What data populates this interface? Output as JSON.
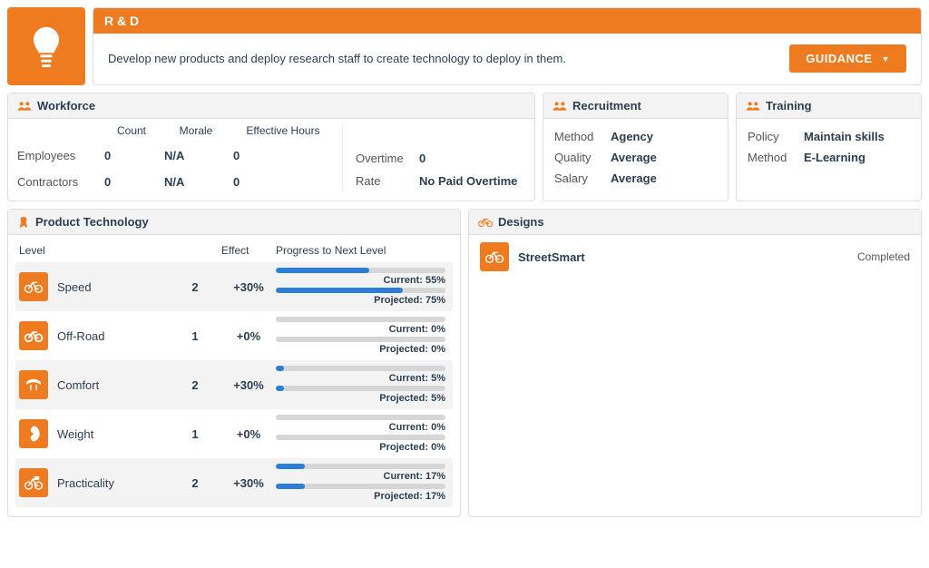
{
  "header": {
    "title": "R & D",
    "description": "Develop new products and deploy research staff to create technology to deploy in them.",
    "guidance_label": "GUIDANCE"
  },
  "workforce": {
    "title": "Workforce",
    "columns": {
      "count": "Count",
      "morale": "Morale",
      "hours": "Effective Hours"
    },
    "rows": {
      "employees_label": "Employees",
      "contractors_label": "Contractors",
      "employees": {
        "count": "0",
        "morale": "N/A",
        "hours": "0"
      },
      "contractors": {
        "count": "0",
        "morale": "N/A",
        "hours": "0"
      }
    },
    "overtime_label": "Overtime",
    "overtime_value": "0",
    "rate_label": "Rate",
    "rate_value": "No Paid Overtime"
  },
  "recruitment": {
    "title": "Recruitment",
    "method_label": "Method",
    "method_value": "Agency",
    "quality_label": "Quality",
    "quality_value": "Average",
    "salary_label": "Salary",
    "salary_value": "Average"
  },
  "training": {
    "title": "Training",
    "policy_label": "Policy",
    "policy_value": "Maintain skills",
    "method_label": "Method",
    "method_value": "E-Learning"
  },
  "product_tech": {
    "title": "Product Technology",
    "headers": {
      "level": "Level",
      "effect": "Effect",
      "progress": "Progress to Next Level"
    },
    "current_prefix": "Current: ",
    "projected_prefix": "Projected: ",
    "rows": [
      {
        "name": "Speed",
        "level": "2",
        "effect": "+30%",
        "current": 55,
        "projected": 75,
        "current_label": "Current: 55%",
        "projected_label": "Projected: 75%"
      },
      {
        "name": "Off-Road",
        "level": "1",
        "effect": "+0%",
        "current": 0,
        "projected": 0,
        "current_label": "Current: 0%",
        "projected_label": "Projected: 0%"
      },
      {
        "name": "Comfort",
        "level": "2",
        "effect": "+30%",
        "current": 5,
        "projected": 5,
        "current_label": "Current: 5%",
        "projected_label": "Projected: 5%"
      },
      {
        "name": "Weight",
        "level": "1",
        "effect": "+0%",
        "current": 0,
        "projected": 0,
        "current_label": "Current: 0%",
        "projected_label": "Projected: 0%"
      },
      {
        "name": "Practicality",
        "level": "2",
        "effect": "+30%",
        "current": 17,
        "projected": 17,
        "current_label": "Current: 17%",
        "projected_label": "Projected: 17%"
      }
    ]
  },
  "designs": {
    "title": "Designs",
    "items": [
      {
        "name": "StreetSmart",
        "status": "Completed"
      }
    ]
  }
}
